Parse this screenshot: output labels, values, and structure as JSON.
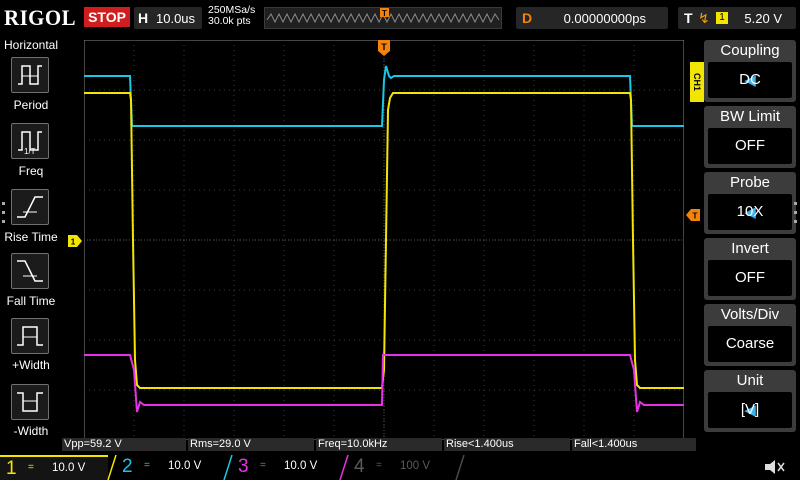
{
  "header": {
    "brand": "RIGOL",
    "run_state": "STOP",
    "horizontal_key": "H",
    "timebase": "10.0us",
    "sample_rate": "250MSa/s",
    "memory_depth": "30.0k pts",
    "delay_key": "D",
    "delay_value": "0.00000000ps",
    "trigger_key": "T",
    "trigger_source": "1",
    "trigger_level": "5.20 V"
  },
  "left_menu": {
    "title": "Horizontal",
    "items": [
      {
        "label": "Period",
        "icon": "period-icon"
      },
      {
        "label": "Freq",
        "icon": "frequency-icon"
      },
      {
        "label": "Rise Time",
        "icon": "rise-time-icon"
      },
      {
        "label": "Fall Time",
        "icon": "fall-time-icon"
      },
      {
        "label": "+Width",
        "icon": "positive-width-icon"
      },
      {
        "label": "-Width",
        "icon": "negative-width-icon"
      }
    ]
  },
  "right_menu": {
    "channel_tab": "CH1",
    "items": [
      {
        "title": "Coupling",
        "value": "DC"
      },
      {
        "title": "BW Limit",
        "value": "OFF"
      },
      {
        "title": "Probe",
        "value": "10X"
      },
      {
        "title": "Invert",
        "value": "OFF"
      },
      {
        "title": "Volts/Div",
        "value": "Coarse"
      },
      {
        "title": "Unit",
        "value": "[V]"
      }
    ]
  },
  "markers": {
    "ch1_marker": "1",
    "trigger_position_marker": "T"
  },
  "measurements": [
    "Vpp=59.2 V",
    "Rms=29.0 V",
    "Freq=10.0kHz",
    "Rise<1.400us",
    "Fall<1.400us"
  ],
  "channels": [
    {
      "num": "1",
      "coupling": "=",
      "scale": "10.0 V",
      "color": "#f2e600",
      "active": true
    },
    {
      "num": "2",
      "coupling": "=",
      "scale": "10.0 V",
      "color": "#19c8e6",
      "active": false
    },
    {
      "num": "3",
      "coupling": "=",
      "scale": "10.0 V",
      "color": "#e632e6",
      "active": false
    },
    {
      "num": "4",
      "coupling": "=",
      "scale": "100 V",
      "color": "#4a74d8",
      "active": false
    }
  ],
  "colors": {
    "ch1": "#f2e600",
    "ch2": "#19c8e6",
    "ch3": "#e632e6",
    "ch4": "#4a74d8",
    "trigger": "#f5820a",
    "stop": "#d01e1e"
  }
}
